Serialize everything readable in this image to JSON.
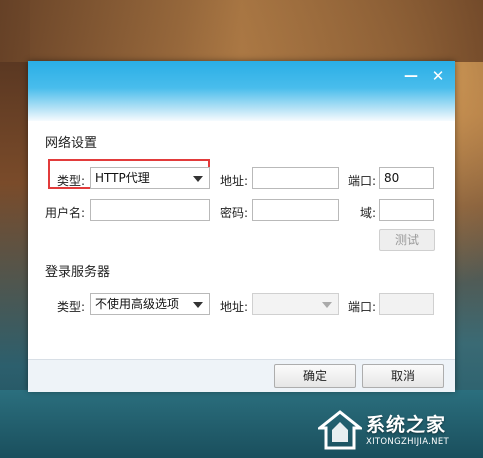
{
  "network_settings": {
    "section_title": "网络设置",
    "type_label": "类型:",
    "type_value": "HTTP代理",
    "address_label": "地址:",
    "address_value": "",
    "port_label": "端口:",
    "port_value": "80",
    "username_label": "用户名:",
    "username_value": "",
    "password_label": "密码:",
    "password_value": "",
    "domain_label": "域:",
    "domain_value": "",
    "test_button": "测试"
  },
  "login_server": {
    "section_title": "登录服务器",
    "type_label": "类型:",
    "type_value": "不使用高级选项",
    "address_label": "地址:",
    "address_value": "",
    "port_label": "端口:",
    "port_value": ""
  },
  "footer": {
    "ok_button": "确定",
    "cancel_button": "取消"
  },
  "titlebar": {
    "minimize_glyph": "—",
    "close_glyph": "✕"
  },
  "watermark": {
    "text": "系统之家",
    "url": "XITONGZHIJIA.NET"
  },
  "colors": {
    "titlebar_accent": "#2aaee6",
    "highlight_border": "#e23b3b"
  }
}
